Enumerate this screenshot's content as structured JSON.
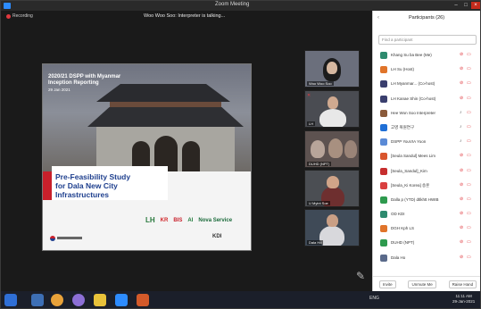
{
  "window": {
    "title": "Zoom Meeting"
  },
  "meeting": {
    "recording_label": "Recording",
    "talking_label": "Woo Woo Soo: Interpreter is talking..."
  },
  "slide": {
    "heading_line1": "2020/21 DSPP with Myanmar",
    "heading_line2": "Inception Reporting",
    "date": "29 Jan 2021",
    "title_line1": "Pre-Feasibility Study",
    "title_line2": "for Dala New City Infrastructures",
    "logos": [
      "LH",
      "KR",
      "BIS",
      "AI",
      "Nova Service"
    ],
    "kdi": "KDI"
  },
  "thumbnails": [
    {
      "name": "Woo Woo Soo"
    },
    {
      "name": "LH"
    },
    {
      "name": "DUHD (NPT)"
    },
    {
      "name": "U Myint Soe"
    },
    {
      "name": "Dala Ho"
    }
  ],
  "participants_panel": {
    "title": "Participants (26)",
    "search_placeholder": "Find a participant",
    "items": [
      {
        "name": "Khang Su ba Bee (Me)",
        "color": "#2d8a6e",
        "mic": "muted"
      },
      {
        "name": "LH Su (Host)",
        "color": "#e0742a",
        "mic": "muted"
      },
      {
        "name": "LH Myanmar... (Co-host)",
        "color": "#3a3f6e",
        "mic": "muted"
      },
      {
        "name": "LH Kanae Shin (Co-host)",
        "color": "#3a3f6e",
        "mic": "muted"
      },
      {
        "name": "Hee Won Soo Interpreter",
        "color": "#8a5a3a",
        "mic": "live"
      },
      {
        "name": "고영 복원연구",
        "color": "#1f6fd6",
        "mic": "live"
      },
      {
        "name": "DSPP YouVIA Yoon",
        "color": "#5a8ad6",
        "mic": "live"
      },
      {
        "name": "[Seula Sandul] Mees Lim",
        "color": "#d9552d",
        "mic": "muted"
      },
      {
        "name": "[Seula_Sandul]_Kim",
        "color": "#c62e2e",
        "mic": "muted"
      },
      {
        "name": "[Seula_Ki Korea] 송훈",
        "color": "#d94040",
        "mic": "muted"
      },
      {
        "name": "Dalla p (YTD) dtlkhtt HWIB",
        "color": "#2e9a4e",
        "mic": "muted"
      },
      {
        "name": "OD KDI",
        "color": "#2d8a6e",
        "mic": "muted"
      },
      {
        "name": "DGH Kph LS",
        "color": "#e0742a",
        "mic": "muted"
      },
      {
        "name": "DUHD (NPT)",
        "color": "#2e9a4e",
        "mic": "muted"
      },
      {
        "name": "Dala Ho",
        "color": "#5a6a8a",
        "mic": "muted"
      }
    ],
    "footer": {
      "invite": "Invite",
      "unmute": "Unmute Me",
      "raise_hand": "Raise Hand"
    }
  },
  "taskbar": {
    "tray": "ENG",
    "time": "11:11 AM",
    "date": "29-Jan-2021"
  }
}
